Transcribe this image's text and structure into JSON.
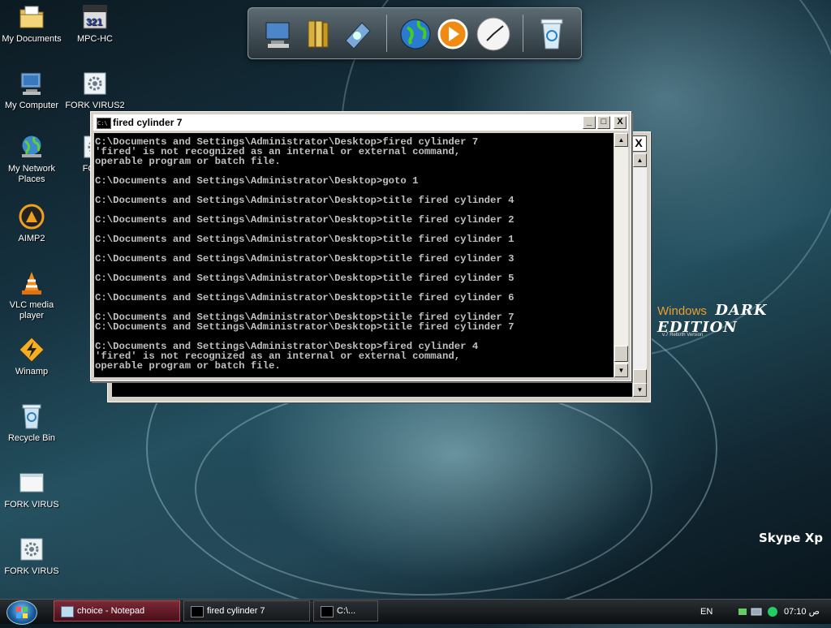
{
  "desktop": {
    "icons": [
      {
        "label": "My Documents",
        "icon": "folder-documents-icon"
      },
      {
        "label": "MPC-HC",
        "icon": "media-player-classic-icon"
      },
      {
        "label": "My Computer",
        "icon": "computer-icon"
      },
      {
        "label": "FORK VIRUS2",
        "icon": "batch-file-gear-icon"
      },
      {
        "label": "My Network Places",
        "icon": "network-globe-icon"
      },
      {
        "label": "FORK",
        "icon": "batch-file-gear-icon"
      },
      {
        "label": "AIMP2",
        "icon": "aimp-player-icon"
      },
      {
        "label": "VLC media player",
        "icon": "vlc-cone-icon"
      },
      {
        "label": "Winamp",
        "icon": "winamp-bolt-icon"
      },
      {
        "label": "Recycle Bin",
        "icon": "recycle-bin-icon"
      },
      {
        "label": "FORK VIRUS",
        "icon": "window-file-icon"
      },
      {
        "label": "FORK VIRUS",
        "icon": "batch-file-gear-icon"
      }
    ],
    "branding": {
      "windows_word": "Windows",
      "edition": "DARK EDITION",
      "version": "v.7 Rebirth Version",
      "skype": "Skype Xp"
    }
  },
  "dock": {
    "items": [
      "computer-icon",
      "folder-icon",
      "network-drive-icon",
      "globe-icon",
      "media-play-icon",
      "clock-icon",
      "recycle-bin-icon"
    ]
  },
  "back_window": {
    "close_label": "X"
  },
  "cmd_window": {
    "title": "fired cylinder 7",
    "buttons": {
      "minimize": "_",
      "maximize": "□",
      "close": "X"
    },
    "lines": [
      "C:\\Documents and Settings\\Administrator\\Desktop>fired cylinder 7",
      "'fired' is not recognized as an internal or external command,",
      "operable program or batch file.",
      "",
      "C:\\Documents and Settings\\Administrator\\Desktop>goto 1",
      "",
      "C:\\Documents and Settings\\Administrator\\Desktop>title fired cylinder 4",
      "",
      "C:\\Documents and Settings\\Administrator\\Desktop>title fired cylinder 2",
      "",
      "C:\\Documents and Settings\\Administrator\\Desktop>title fired cylinder 1",
      "",
      "C:\\Documents and Settings\\Administrator\\Desktop>title fired cylinder 3",
      "",
      "C:\\Documents and Settings\\Administrator\\Desktop>title fired cylinder 5",
      "",
      "C:\\Documents and Settings\\Administrator\\Desktop>title fired cylinder 6",
      "",
      "C:\\Documents and Settings\\Administrator\\Desktop>title fired cylinder 7",
      "C:\\Documents and Settings\\Administrator\\Desktop>title fired cylinder 7",
      "",
      "C:\\Documents and Settings\\Administrator\\Desktop>fired cylinder 4",
      "'fired' is not recognized as an internal or external command,",
      "operable program or batch file."
    ]
  },
  "taskbar": {
    "tasks": [
      {
        "label": "choice - Notepad",
        "icon": "notepad-icon"
      },
      {
        "label": "fired cylinder 7",
        "icon": "cmd-icon"
      },
      {
        "label": "C:\\...",
        "icon": "cmd-icon"
      }
    ],
    "language": "EN",
    "clock": "07:10 ص"
  }
}
